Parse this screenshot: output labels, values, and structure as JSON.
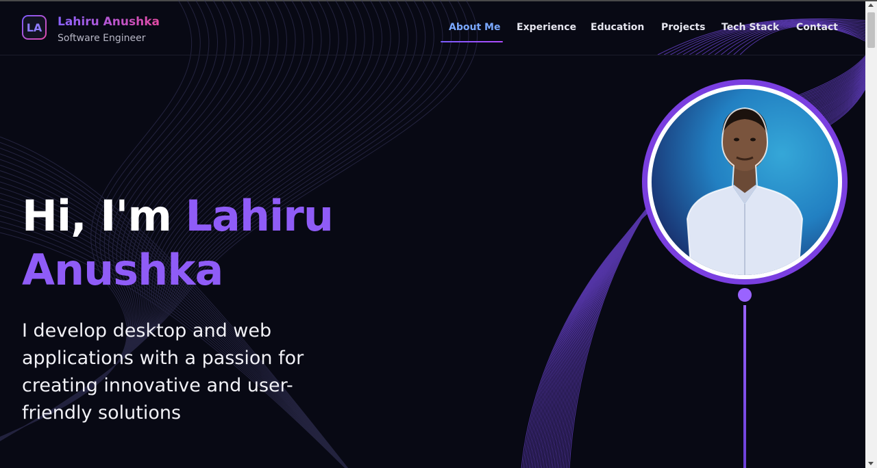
{
  "brand": {
    "initials": "LA",
    "name": "Lahiru Anushka",
    "subtitle": "Software Engineer"
  },
  "nav": {
    "items": [
      {
        "label": "About Me",
        "active": true
      },
      {
        "label": "Experience",
        "active": false
      },
      {
        "label": "Education",
        "active": false
      },
      {
        "label": "Projects",
        "active": false
      },
      {
        "label": "Tech Stack",
        "active": false
      },
      {
        "label": "Contact",
        "active": false
      }
    ]
  },
  "hero": {
    "greeting": "Hi, I'm",
    "first_name": "Lahiru",
    "last_name": "Anushka",
    "description": "I develop desktop and web applications with a passion for creating innovative and user-friendly solutions"
  },
  "profile": {
    "photo_icon": "profile-photo"
  },
  "colors": {
    "background": "#080914",
    "accent": "#8f5cf7",
    "nav_active": "#7aa8ff",
    "brand_gradient_start": "#8a63ff",
    "brand_gradient_end": "#e24aa3"
  }
}
